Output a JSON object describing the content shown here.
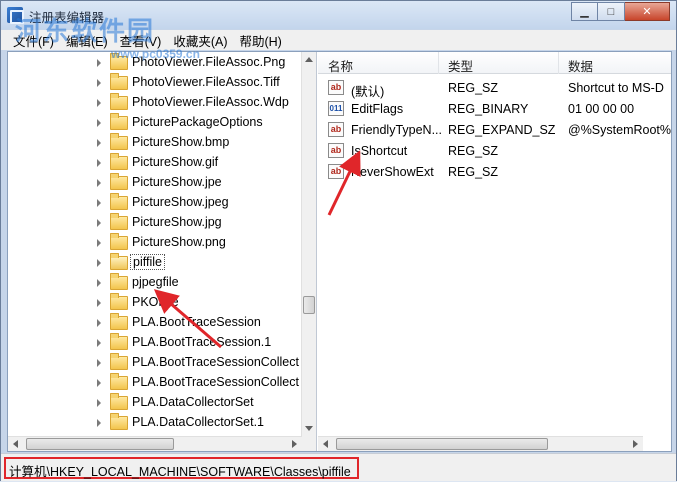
{
  "window": {
    "title": "注册表编辑器",
    "watermark": "河东软件园",
    "watermark_url": "www.pc0359.cn"
  },
  "menu": [
    "文件(F)",
    "编辑(E)",
    "查看(V)",
    "收藏夹(A)",
    "帮助(H)"
  ],
  "tree": {
    "items": [
      "PhotoViewer.FileAssoc.Png",
      "PhotoViewer.FileAssoc.Tiff",
      "PhotoViewer.FileAssoc.Wdp",
      "PicturePackageOptions",
      "PictureShow.bmp",
      "PictureShow.gif",
      "PictureShow.jpe",
      "PictureShow.jpeg",
      "PictureShow.jpg",
      "PictureShow.png",
      "piffile",
      "pjpegfile",
      "PKOFile",
      "PLA.BootTraceSession",
      "PLA.BootTraceSession.1",
      "PLA.BootTraceSessionCollect",
      "PLA.BootTraceSessionCollect",
      "PLA.DataCollectorSet",
      "PLA.DataCollectorSet.1"
    ],
    "selected": "piffile"
  },
  "list": {
    "columns": [
      "名称",
      "类型",
      "数据"
    ],
    "rows": [
      {
        "icon": "string-value-icon",
        "name": "(默认)",
        "type": "REG_SZ",
        "data": "Shortcut to MS-D"
      },
      {
        "icon": "binary-value-icon",
        "name": "EditFlags",
        "type": "REG_BINARY",
        "data": "01 00 00 00"
      },
      {
        "icon": "string-value-icon",
        "name": "FriendlyTypeN...",
        "type": "REG_EXPAND_SZ",
        "data": "@%SystemRoot%"
      },
      {
        "icon": "string-value-icon",
        "name": "IsShortcut",
        "type": "REG_SZ",
        "data": ""
      },
      {
        "icon": "string-value-icon",
        "name": "NeverShowExt",
        "type": "REG_SZ",
        "data": ""
      }
    ]
  },
  "status": {
    "path": "计算机\\HKEY_LOCAL_MACHINE\\SOFTWARE\\Classes\\piffile"
  },
  "colors": {
    "annotation_red": "#e0262a",
    "title_bg": "#c3d5ec"
  }
}
